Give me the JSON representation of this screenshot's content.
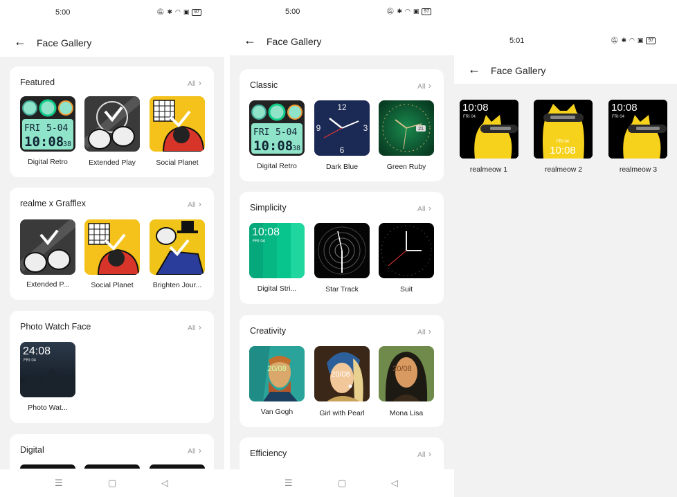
{
  "screen1": {
    "time": "5:00",
    "battery": "97",
    "title": "Face Gallery",
    "sections": [
      {
        "title": "Featured",
        "all": "All",
        "items": [
          "Digital Retro",
          "Extended Play",
          "Social Planet"
        ]
      },
      {
        "title": "realme x Grafflex",
        "all": "All",
        "items": [
          "Extended P...",
          "Social Planet",
          "Brighten Jour..."
        ]
      },
      {
        "title": "Photo Watch Face",
        "all": "All",
        "items": [
          "Photo Wat..."
        ]
      },
      {
        "title": "Digital",
        "all": "All",
        "items": []
      }
    ]
  },
  "screen2": {
    "time": "5:00",
    "battery": "97",
    "title": "Face Gallery",
    "sections": [
      {
        "title": "Classic",
        "all": "All",
        "items": [
          "Digital Retro",
          "Dark Blue",
          "Green Ruby"
        ]
      },
      {
        "title": "Simplicity",
        "all": "All",
        "items": [
          "Digital Stri...",
          "Star Track",
          "Suit"
        ]
      },
      {
        "title": "Creativity",
        "all": "All",
        "items": [
          "Van Gogh",
          "Girl with Pearl",
          "Mona Lisa"
        ]
      },
      {
        "title": "Efficiency",
        "all": "All",
        "items": []
      }
    ]
  },
  "screen3": {
    "time": "5:01",
    "battery": "97",
    "title": "Face Gallery",
    "items": [
      "realmeow 1",
      "realmeow 2",
      "realmeow 3"
    ]
  },
  "faces": {
    "retro_day": "FRI",
    "retro_date": "5-04",
    "retro_time": "10:08",
    "retro_sec": "38",
    "dark_blue_12": "12",
    "dark_blue_3": "3",
    "dark_blue_6": "6",
    "dark_blue_9": "9",
    "digital_time": "10:08",
    "digital_date": "FRI 04",
    "photo_time": "24:08",
    "photo_date": "FRI 04",
    "art_time": "20/08",
    "green_ruby_badge": "21",
    "meow_time": "10:08",
    "meow_date": "FRI 04"
  },
  "colors": {
    "accent_green": "#00c896",
    "retro_screen": "#8ee3c8",
    "dark_blue": "#1b2a55",
    "green_ruby": "#0e6b3a",
    "meow_yellow": "#f6d21c"
  },
  "nav": {
    "menu_icon": "menu-icon",
    "home_icon": "home-icon",
    "back_icon": "back-triangle-icon"
  }
}
